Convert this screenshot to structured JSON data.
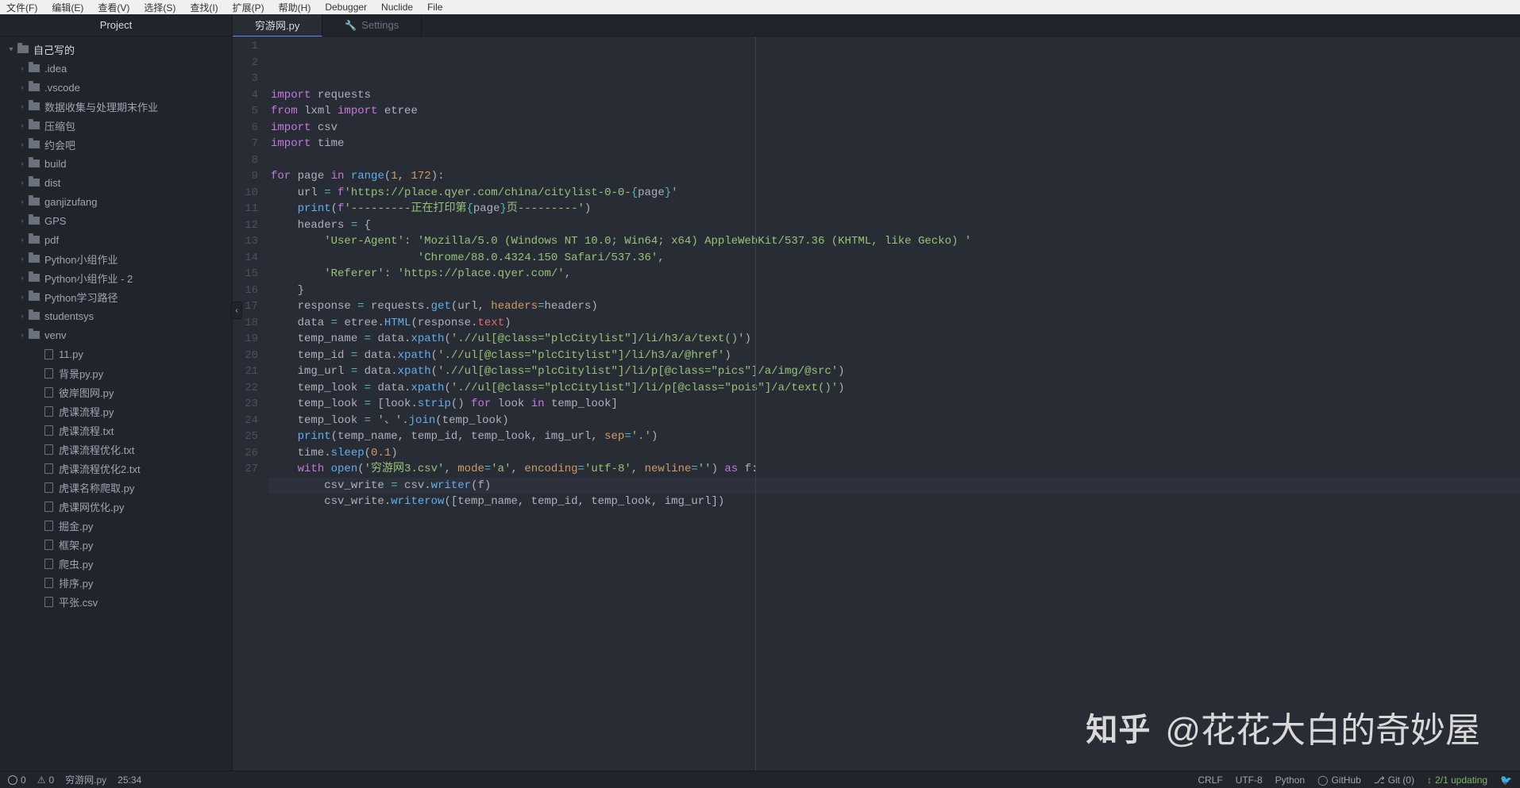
{
  "menubar": [
    "文件(F)",
    "编辑(E)",
    "查看(V)",
    "选择(S)",
    "查找(I)",
    "扩展(P)",
    "帮助(H)",
    "Debugger",
    "Nuclide",
    "File"
  ],
  "sidebar": {
    "title": "Project",
    "root": "自己写的",
    "folders": [
      ".idea",
      ".vscode",
      "数据收集与处理期末作业",
      "压缩包",
      "约会吧",
      "build",
      "dist",
      "ganjizufang",
      "GPS",
      "pdf",
      "Python小组作业",
      "Python小组作业 - 2",
      "Python学习路径",
      "studentsys",
      "venv"
    ],
    "files": [
      "11.py",
      "背景py.py",
      "彼岸图网.py",
      "虎课流程.py",
      "虎课流程.txt",
      "虎课流程优化.txt",
      "虎课流程优化2.txt",
      "虎课名称爬取.py",
      "虎课网优化.py",
      "掘金.py",
      "框架.py",
      "爬虫.py",
      "排序.py",
      "平张.csv"
    ]
  },
  "tabs": [
    {
      "label": "穷游网.py",
      "active": true
    },
    {
      "label": "Settings",
      "active": false,
      "icon": "wrench"
    }
  ],
  "code": {
    "lines": [
      [
        {
          "t": "import ",
          "c": "kw"
        },
        {
          "t": "requests",
          "c": "plain"
        }
      ],
      [
        {
          "t": "from ",
          "c": "kw"
        },
        {
          "t": "lxml ",
          "c": "plain"
        },
        {
          "t": "import ",
          "c": "kw"
        },
        {
          "t": "etree",
          "c": "plain"
        }
      ],
      [
        {
          "t": "import ",
          "c": "kw"
        },
        {
          "t": "csv",
          "c": "plain"
        }
      ],
      [
        {
          "t": "import ",
          "c": "kw"
        },
        {
          "t": "time",
          "c": "plain"
        }
      ],
      [],
      [
        {
          "t": "for ",
          "c": "kw"
        },
        {
          "t": "page ",
          "c": "plain"
        },
        {
          "t": "in ",
          "c": "kw"
        },
        {
          "t": "range",
          "c": "fn"
        },
        {
          "t": "(",
          "c": "plain"
        },
        {
          "t": "1",
          "c": "num"
        },
        {
          "t": ", ",
          "c": "plain"
        },
        {
          "t": "172",
          "c": "num"
        },
        {
          "t": "):",
          "c": "plain"
        }
      ],
      [
        {
          "t": "    url ",
          "c": "plain"
        },
        {
          "t": "= ",
          "c": "op"
        },
        {
          "t": "f",
          "c": "kw"
        },
        {
          "t": "'https://place.qyer.com/china/citylist-0-0-",
          "c": "str"
        },
        {
          "t": "{",
          "c": "op"
        },
        {
          "t": "page",
          "c": "plain"
        },
        {
          "t": "}",
          "c": "op"
        },
        {
          "t": "'",
          "c": "str"
        }
      ],
      [
        {
          "t": "    ",
          "c": "plain"
        },
        {
          "t": "print",
          "c": "fn"
        },
        {
          "t": "(",
          "c": "plain"
        },
        {
          "t": "f",
          "c": "kw"
        },
        {
          "t": "'---------正在打印第",
          "c": "str"
        },
        {
          "t": "{",
          "c": "op"
        },
        {
          "t": "page",
          "c": "plain"
        },
        {
          "t": "}",
          "c": "op"
        },
        {
          "t": "页---------'",
          "c": "str"
        },
        {
          "t": ")",
          "c": "plain"
        }
      ],
      [
        {
          "t": "    headers ",
          "c": "plain"
        },
        {
          "t": "= ",
          "c": "op"
        },
        {
          "t": "{",
          "c": "plain"
        }
      ],
      [
        {
          "t": "        ",
          "c": "plain"
        },
        {
          "t": "'User-Agent'",
          "c": "str"
        },
        {
          "t": ": ",
          "c": "plain"
        },
        {
          "t": "'Mozilla/5.0 (Windows NT 10.0; Win64; x64) AppleWebKit/537.36 (KHTML, like Gecko) '",
          "c": "str"
        }
      ],
      [
        {
          "t": "                      ",
          "c": "plain"
        },
        {
          "t": "'Chrome/88.0.4324.150 Safari/537.36'",
          "c": "str"
        },
        {
          "t": ",",
          "c": "plain"
        }
      ],
      [
        {
          "t": "        ",
          "c": "plain"
        },
        {
          "t": "'Referer'",
          "c": "str"
        },
        {
          "t": ": ",
          "c": "plain"
        },
        {
          "t": "'https://place.qyer.com/'",
          "c": "str"
        },
        {
          "t": ",",
          "c": "plain"
        }
      ],
      [
        {
          "t": "    }",
          "c": "plain"
        }
      ],
      [
        {
          "t": "    response ",
          "c": "plain"
        },
        {
          "t": "= ",
          "c": "op"
        },
        {
          "t": "requests.",
          "c": "plain"
        },
        {
          "t": "get",
          "c": "fn"
        },
        {
          "t": "(url, ",
          "c": "plain"
        },
        {
          "t": "headers",
          "c": "attr"
        },
        {
          "t": "=",
          "c": "op"
        },
        {
          "t": "headers)",
          "c": "plain"
        }
      ],
      [
        {
          "t": "    data ",
          "c": "plain"
        },
        {
          "t": "= ",
          "c": "op"
        },
        {
          "t": "etree.",
          "c": "plain"
        },
        {
          "t": "HTML",
          "c": "fn"
        },
        {
          "t": "(response.",
          "c": "plain"
        },
        {
          "t": "text",
          "c": "id"
        },
        {
          "t": ")",
          "c": "plain"
        }
      ],
      [
        {
          "t": "    temp_name ",
          "c": "plain"
        },
        {
          "t": "= ",
          "c": "op"
        },
        {
          "t": "data.",
          "c": "plain"
        },
        {
          "t": "xpath",
          "c": "fn"
        },
        {
          "t": "(",
          "c": "plain"
        },
        {
          "t": "'.//ul[@class=\"plcCitylist\"]/li/h3/a/text()'",
          "c": "str"
        },
        {
          "t": ")",
          "c": "plain"
        }
      ],
      [
        {
          "t": "    temp_id ",
          "c": "plain"
        },
        {
          "t": "= ",
          "c": "op"
        },
        {
          "t": "data.",
          "c": "plain"
        },
        {
          "t": "xpath",
          "c": "fn"
        },
        {
          "t": "(",
          "c": "plain"
        },
        {
          "t": "'.//ul[@class=\"plcCitylist\"]/li/h3/a/@href'",
          "c": "str"
        },
        {
          "t": ")",
          "c": "plain"
        }
      ],
      [
        {
          "t": "    img_url ",
          "c": "plain"
        },
        {
          "t": "= ",
          "c": "op"
        },
        {
          "t": "data.",
          "c": "plain"
        },
        {
          "t": "xpath",
          "c": "fn"
        },
        {
          "t": "(",
          "c": "plain"
        },
        {
          "t": "'.//ul[@class=\"plcCitylist\"]/li/p[@class=\"pics\"]/a/img/@src'",
          "c": "str"
        },
        {
          "t": ")",
          "c": "plain"
        }
      ],
      [
        {
          "t": "    temp_look ",
          "c": "plain"
        },
        {
          "t": "= ",
          "c": "op"
        },
        {
          "t": "data.",
          "c": "plain"
        },
        {
          "t": "xpath",
          "c": "fn"
        },
        {
          "t": "(",
          "c": "plain"
        },
        {
          "t": "'.//ul[@class=\"plcCitylist\"]/li/p[@class=\"pois\"]/a/text()'",
          "c": "str"
        },
        {
          "t": ")",
          "c": "plain"
        }
      ],
      [
        {
          "t": "    temp_look ",
          "c": "plain"
        },
        {
          "t": "= ",
          "c": "op"
        },
        {
          "t": "[look.",
          "c": "plain"
        },
        {
          "t": "strip",
          "c": "fn"
        },
        {
          "t": "() ",
          "c": "plain"
        },
        {
          "t": "for ",
          "c": "kw"
        },
        {
          "t": "look ",
          "c": "plain"
        },
        {
          "t": "in ",
          "c": "kw"
        },
        {
          "t": "temp_look]",
          "c": "plain"
        }
      ],
      [
        {
          "t": "    temp_look ",
          "c": "plain"
        },
        {
          "t": "= ",
          "c": "op"
        },
        {
          "t": "'、'",
          "c": "str"
        },
        {
          "t": ".",
          "c": "plain"
        },
        {
          "t": "join",
          "c": "fn"
        },
        {
          "t": "(temp_look)",
          "c": "plain"
        }
      ],
      [
        {
          "t": "    ",
          "c": "plain"
        },
        {
          "t": "print",
          "c": "fn"
        },
        {
          "t": "(temp_name, temp_id, temp_look, img_url, ",
          "c": "plain"
        },
        {
          "t": "sep",
          "c": "attr"
        },
        {
          "t": "=",
          "c": "op"
        },
        {
          "t": "'.'",
          "c": "str"
        },
        {
          "t": ")",
          "c": "plain"
        }
      ],
      [
        {
          "t": "    time.",
          "c": "plain"
        },
        {
          "t": "sleep",
          "c": "fn"
        },
        {
          "t": "(",
          "c": "plain"
        },
        {
          "t": "0.1",
          "c": "num"
        },
        {
          "t": ")",
          "c": "plain"
        }
      ],
      [
        {
          "t": "    ",
          "c": "plain"
        },
        {
          "t": "with ",
          "c": "kw"
        },
        {
          "t": "open",
          "c": "fn"
        },
        {
          "t": "(",
          "c": "plain"
        },
        {
          "t": "'穷游网3.csv'",
          "c": "str"
        },
        {
          "t": ", ",
          "c": "plain"
        },
        {
          "t": "mode",
          "c": "attr"
        },
        {
          "t": "=",
          "c": "op"
        },
        {
          "t": "'a'",
          "c": "str"
        },
        {
          "t": ", ",
          "c": "plain"
        },
        {
          "t": "encoding",
          "c": "attr"
        },
        {
          "t": "=",
          "c": "op"
        },
        {
          "t": "'utf-8'",
          "c": "str"
        },
        {
          "t": ", ",
          "c": "plain"
        },
        {
          "t": "newline",
          "c": "attr"
        },
        {
          "t": "=",
          "c": "op"
        },
        {
          "t": "''",
          "c": "str"
        },
        {
          "t": ") ",
          "c": "plain"
        },
        {
          "t": "as ",
          "c": "kw"
        },
        {
          "t": "f:",
          "c": "plain"
        }
      ],
      [
        {
          "t": "        csv_write ",
          "c": "plain"
        },
        {
          "t": "= ",
          "c": "op"
        },
        {
          "t": "csv.",
          "c": "plain"
        },
        {
          "t": "writer",
          "c": "fn"
        },
        {
          "t": "(f)",
          "c": "plain"
        }
      ],
      [
        {
          "t": "        csv_write.",
          "c": "plain"
        },
        {
          "t": "writerow",
          "c": "fn"
        },
        {
          "t": "([temp_name, temp_id, temp_look, img_url])",
          "c": "plain"
        }
      ],
      []
    ],
    "current_line_index": 24
  },
  "statusbar": {
    "errors": "0",
    "warnings": "0",
    "file": "穷游网.py",
    "cursor": "25:34",
    "eol": "CRLF",
    "encoding": "UTF-8",
    "language": "Python",
    "github": "GitHub",
    "git": "Git (0)",
    "updating": "2/1 updating"
  },
  "watermark": {
    "logo": "知乎",
    "text": "@花花大白的奇妙屋"
  }
}
